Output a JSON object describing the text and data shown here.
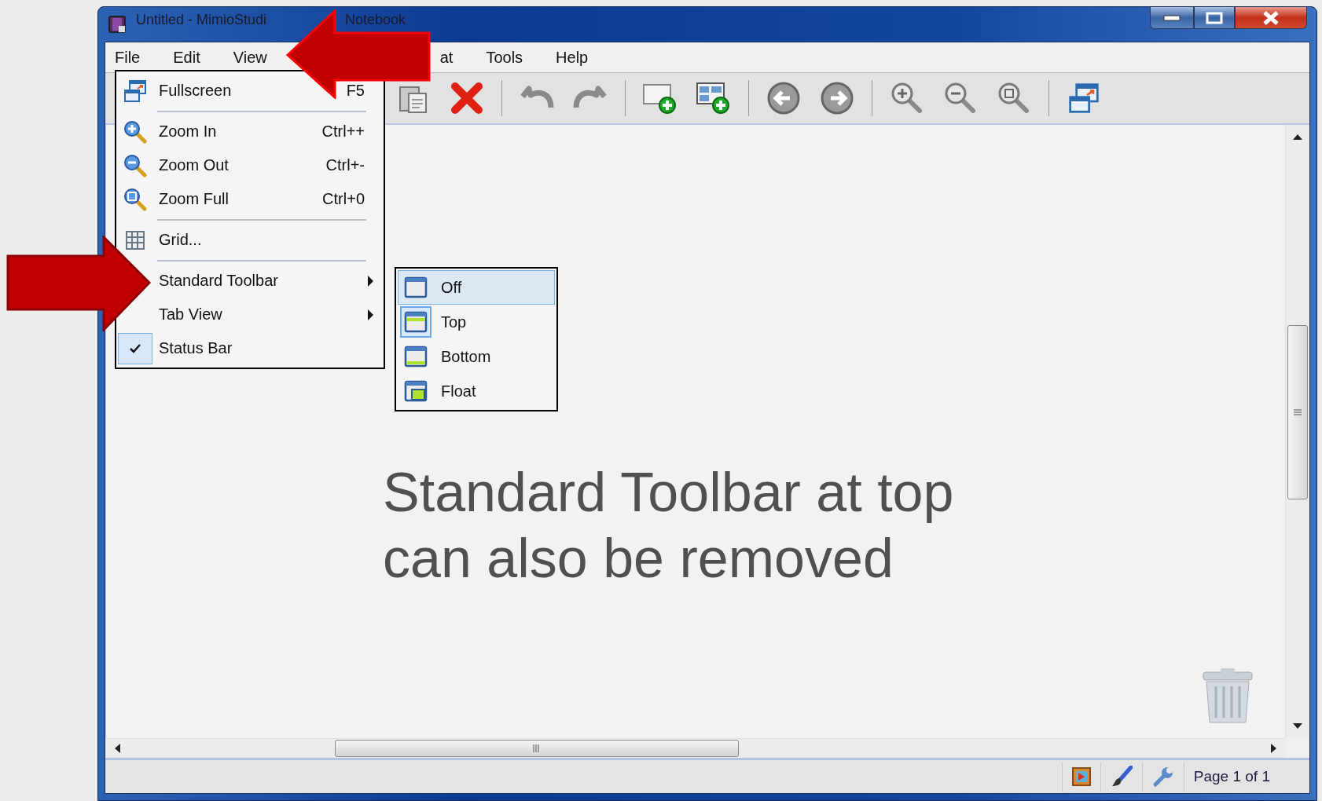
{
  "window": {
    "title_parts": [
      "Untitled - MimioStudi",
      "Notebook"
    ]
  },
  "menu_bar": [
    {
      "label": "File",
      "kind": "full"
    },
    {
      "label": "Edit",
      "kind": "full"
    },
    {
      "label": "View",
      "kind": "full"
    },
    {
      "label": "at",
      "kind": "partial"
    },
    {
      "label": "Tools",
      "kind": "full"
    },
    {
      "label": "Help",
      "kind": "full"
    }
  ],
  "view_menu": [
    {
      "kind": "item",
      "label": "Fullscreen",
      "shortcut": "F5",
      "checked": false
    },
    {
      "kind": "separator"
    },
    {
      "kind": "item",
      "label": "Zoom In",
      "shortcut": "Ctrl++",
      "checked": false
    },
    {
      "kind": "item",
      "label": "Zoom Out",
      "shortcut": "Ctrl+-",
      "checked": false
    },
    {
      "kind": "item",
      "label": "Zoom Full",
      "shortcut": "Ctrl+0",
      "checked": false
    },
    {
      "kind": "separator"
    },
    {
      "kind": "item",
      "label": "Grid...",
      "checked": false
    },
    {
      "kind": "separator"
    },
    {
      "kind": "submenu",
      "label": "Standard Toolbar",
      "checked": false
    },
    {
      "kind": "submenu",
      "label": "Tab View",
      "checked": false
    },
    {
      "kind": "item",
      "label": "Status Bar",
      "checked": true
    }
  ],
  "toolbar_submenu": [
    {
      "label": "Off",
      "highlighted": true,
      "checked": false
    },
    {
      "label": "Top",
      "highlighted": false,
      "checked": true
    },
    {
      "label": "Bottom",
      "highlighted": false,
      "checked": false
    },
    {
      "label": "Float",
      "highlighted": false,
      "checked": false
    }
  ],
  "canvas_note": [
    "Standard Toolbar at top",
    "can also be removed"
  ],
  "status_bar": {
    "page_indicator": "Page 1 of 1"
  }
}
